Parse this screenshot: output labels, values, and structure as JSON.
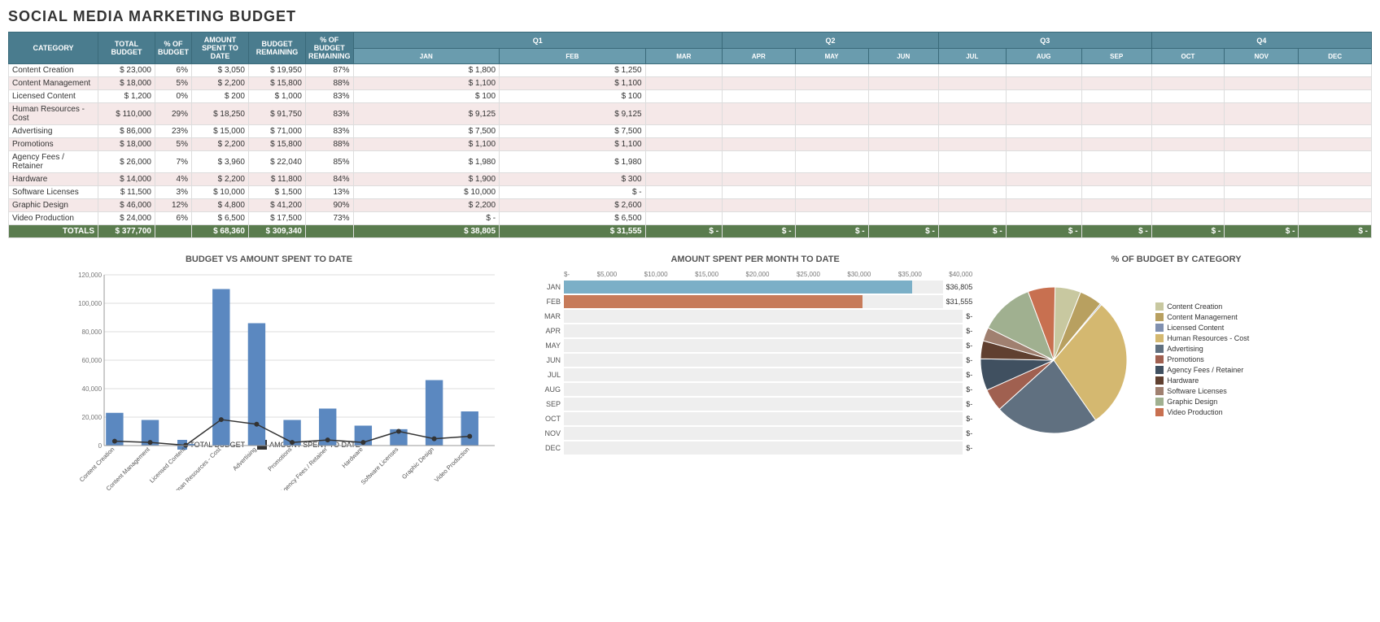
{
  "title": "SOCIAL MEDIA MARKETING BUDGET",
  "table": {
    "headers": {
      "category": "CATEGORY",
      "total_budget": "TOTAL BUDGET",
      "pct_of_budget": "% OF BUDGET",
      "amount_spent": "AMOUNT SPENT TO DATE",
      "budget_remaining": "BUDGET REMAINING",
      "pct_remaining": "% OF BUDGET REMAINING",
      "q1": "Q1",
      "q2": "Q2",
      "q3": "Q3",
      "q4": "Q4",
      "jan": "JAN",
      "feb": "FEB",
      "mar": "MAR",
      "apr": "APR",
      "may": "MAY",
      "jun": "JUN",
      "jul": "JUL",
      "aug": "AUG",
      "sep": "SEP",
      "oct": "OCT",
      "nov": "NOV",
      "dec": "DEC"
    },
    "rows": [
      {
        "category": "Content Creation",
        "total": "23,000",
        "pct": "6%",
        "spent": "3,050",
        "remaining": "19,950",
        "pct_rem": "87%",
        "jan": "1,800",
        "feb": "1,250"
      },
      {
        "category": "Content Management",
        "total": "18,000",
        "pct": "5%",
        "spent": "2,200",
        "remaining": "15,800",
        "pct_rem": "88%",
        "jan": "1,100",
        "feb": "1,100"
      },
      {
        "category": "Licensed Content",
        "total": "1,200",
        "pct": "0%",
        "spent": "200",
        "remaining": "1,000",
        "pct_rem": "83%",
        "jan": "100",
        "feb": "100"
      },
      {
        "category": "Human Resources - Cost",
        "total": "110,000",
        "pct": "29%",
        "spent": "18,250",
        "remaining": "91,750",
        "pct_rem": "83%",
        "jan": "9,125",
        "feb": "9,125"
      },
      {
        "category": "Advertising",
        "total": "86,000",
        "pct": "23%",
        "spent": "15,000",
        "remaining": "71,000",
        "pct_rem": "83%",
        "jan": "7,500",
        "feb": "7,500"
      },
      {
        "category": "Promotions",
        "total": "18,000",
        "pct": "5%",
        "spent": "2,200",
        "remaining": "15,800",
        "pct_rem": "88%",
        "jan": "1,100",
        "feb": "1,100"
      },
      {
        "category": "Agency Fees / Retainer",
        "total": "26,000",
        "pct": "7%",
        "spent": "3,960",
        "remaining": "22,040",
        "pct_rem": "85%",
        "jan": "1,980",
        "feb": "1,980"
      },
      {
        "category": "Hardware",
        "total": "14,000",
        "pct": "4%",
        "spent": "2,200",
        "remaining": "11,800",
        "pct_rem": "84%",
        "jan": "1,900",
        "feb": "300"
      },
      {
        "category": "Software Licenses",
        "total": "11,500",
        "pct": "3%",
        "spent": "10,000",
        "remaining": "1,500",
        "pct_rem": "13%",
        "jan": "10,000",
        "feb": "-"
      },
      {
        "category": "Graphic Design",
        "total": "46,000",
        "pct": "12%",
        "spent": "4,800",
        "remaining": "41,200",
        "pct_rem": "90%",
        "jan": "2,200",
        "feb": "2,600"
      },
      {
        "category": "Video Production",
        "total": "24,000",
        "pct": "6%",
        "spent": "6,500",
        "remaining": "17,500",
        "pct_rem": "73%",
        "jan": "-",
        "feb": "6,500"
      }
    ],
    "totals": {
      "label": "TOTALS",
      "total": "377,700",
      "spent": "68,360",
      "remaining": "309,340",
      "jan": "38,805",
      "feb": "31,555",
      "mar": "-",
      "apr": "-",
      "may": "-",
      "jun": "-",
      "jul": "-",
      "aug": "-",
      "sep": "-",
      "oct": "-",
      "nov": "-",
      "dec": "-"
    }
  },
  "bar_chart": {
    "title": "BUDGET vs AMOUNT SPENT TO DATE",
    "legend": {
      "budget": "TOTAL BUDGET",
      "spent": "AMOUNT SPENT TO DATE"
    },
    "y_labels": [
      "0",
      "20000",
      "40000",
      "60000",
      "80000",
      "100000",
      "120000"
    ],
    "bars": [
      {
        "label": "Content Creation",
        "budget": 23000,
        "spent": 3050
      },
      {
        "label": "Content Management",
        "budget": 18000,
        "spent": 2200
      },
      {
        "label": "Licensed Content",
        "budget": 1200,
        "spent": 200
      },
      {
        "label": "Human Resources - Cost",
        "budget": 110000,
        "spent": 18250
      },
      {
        "label": "Advertising",
        "budget": 86000,
        "spent": 15000
      },
      {
        "label": "Promotions",
        "budget": 18000,
        "spent": 2200
      },
      {
        "label": "Agency Fees / Retainer",
        "budget": 26000,
        "spent": 3960
      },
      {
        "label": "Hardware",
        "budget": 14000,
        "spent": 2200
      },
      {
        "label": "Software Licenses",
        "budget": 11500,
        "spent": 10000
      },
      {
        "label": "Graphic Design",
        "budget": 46000,
        "spent": 4800
      },
      {
        "label": "Video Production",
        "budget": 24000,
        "spent": 6500
      }
    ]
  },
  "horiz_chart": {
    "title": "AMOUNT SPENT PER MONTH TO DATE",
    "x_labels": [
      "$-",
      "$5,000",
      "$10,000",
      "$15,000",
      "$20,000",
      "$25,000",
      "$30,000",
      "$35,000",
      "$40,000"
    ],
    "max": 40000,
    "bars": [
      {
        "month": "JAN",
        "value": 36805,
        "label": "$36,805",
        "color": "#7bafc7"
      },
      {
        "month": "FEB",
        "value": 31555,
        "label": "$31,555",
        "color": "#c77b5a"
      },
      {
        "month": "MAR",
        "value": 0,
        "label": "$-",
        "color": "#7bafc7"
      },
      {
        "month": "APR",
        "value": 0,
        "label": "$-",
        "color": "#7bafc7"
      },
      {
        "month": "MAY",
        "value": 0,
        "label": "$-",
        "color": "#7bafc7"
      },
      {
        "month": "JUN",
        "value": 0,
        "label": "$-",
        "color": "#7bafc7"
      },
      {
        "month": "JUL",
        "value": 0,
        "label": "$-",
        "color": "#7bafc7"
      },
      {
        "month": "AUG",
        "value": 0,
        "label": "$-",
        "color": "#7bafc7"
      },
      {
        "month": "SEP",
        "value": 0,
        "label": "$-",
        "color": "#7bafc7"
      },
      {
        "month": "OCT",
        "value": 0,
        "label": "$-",
        "color": "#7bafc7"
      },
      {
        "month": "NOV",
        "value": 0,
        "label": "$-",
        "color": "#7bafc7"
      },
      {
        "month": "DEC",
        "value": 0,
        "label": "$-",
        "color": "#7bafc7"
      }
    ]
  },
  "pie_chart": {
    "title": "% OF BUDGET BY CATEGORY",
    "slices": [
      {
        "label": "Content Creation",
        "value": 6,
        "color": "#c8c8a0"
      },
      {
        "label": "Content Management",
        "value": 5,
        "color": "#b8a060"
      },
      {
        "label": "Licensed Content",
        "value": 0.3,
        "color": "#8090b0"
      },
      {
        "label": "Human Resources - Cost",
        "value": 29,
        "color": "#d4b870"
      },
      {
        "label": "Advertising",
        "value": 23,
        "color": "#607080"
      },
      {
        "label": "Promotions",
        "value": 5,
        "color": "#a06050"
      },
      {
        "label": "Agency Fees / Retainer",
        "value": 7,
        "color": "#405060"
      },
      {
        "label": "Hardware",
        "value": 4,
        "color": "#604030"
      },
      {
        "label": "Software Licenses",
        "value": 3,
        "color": "#a08070"
      },
      {
        "label": "Graphic Design",
        "value": 12,
        "color": "#a0b090"
      },
      {
        "label": "Video Production",
        "value": 6,
        "color": "#c87050"
      }
    ]
  }
}
